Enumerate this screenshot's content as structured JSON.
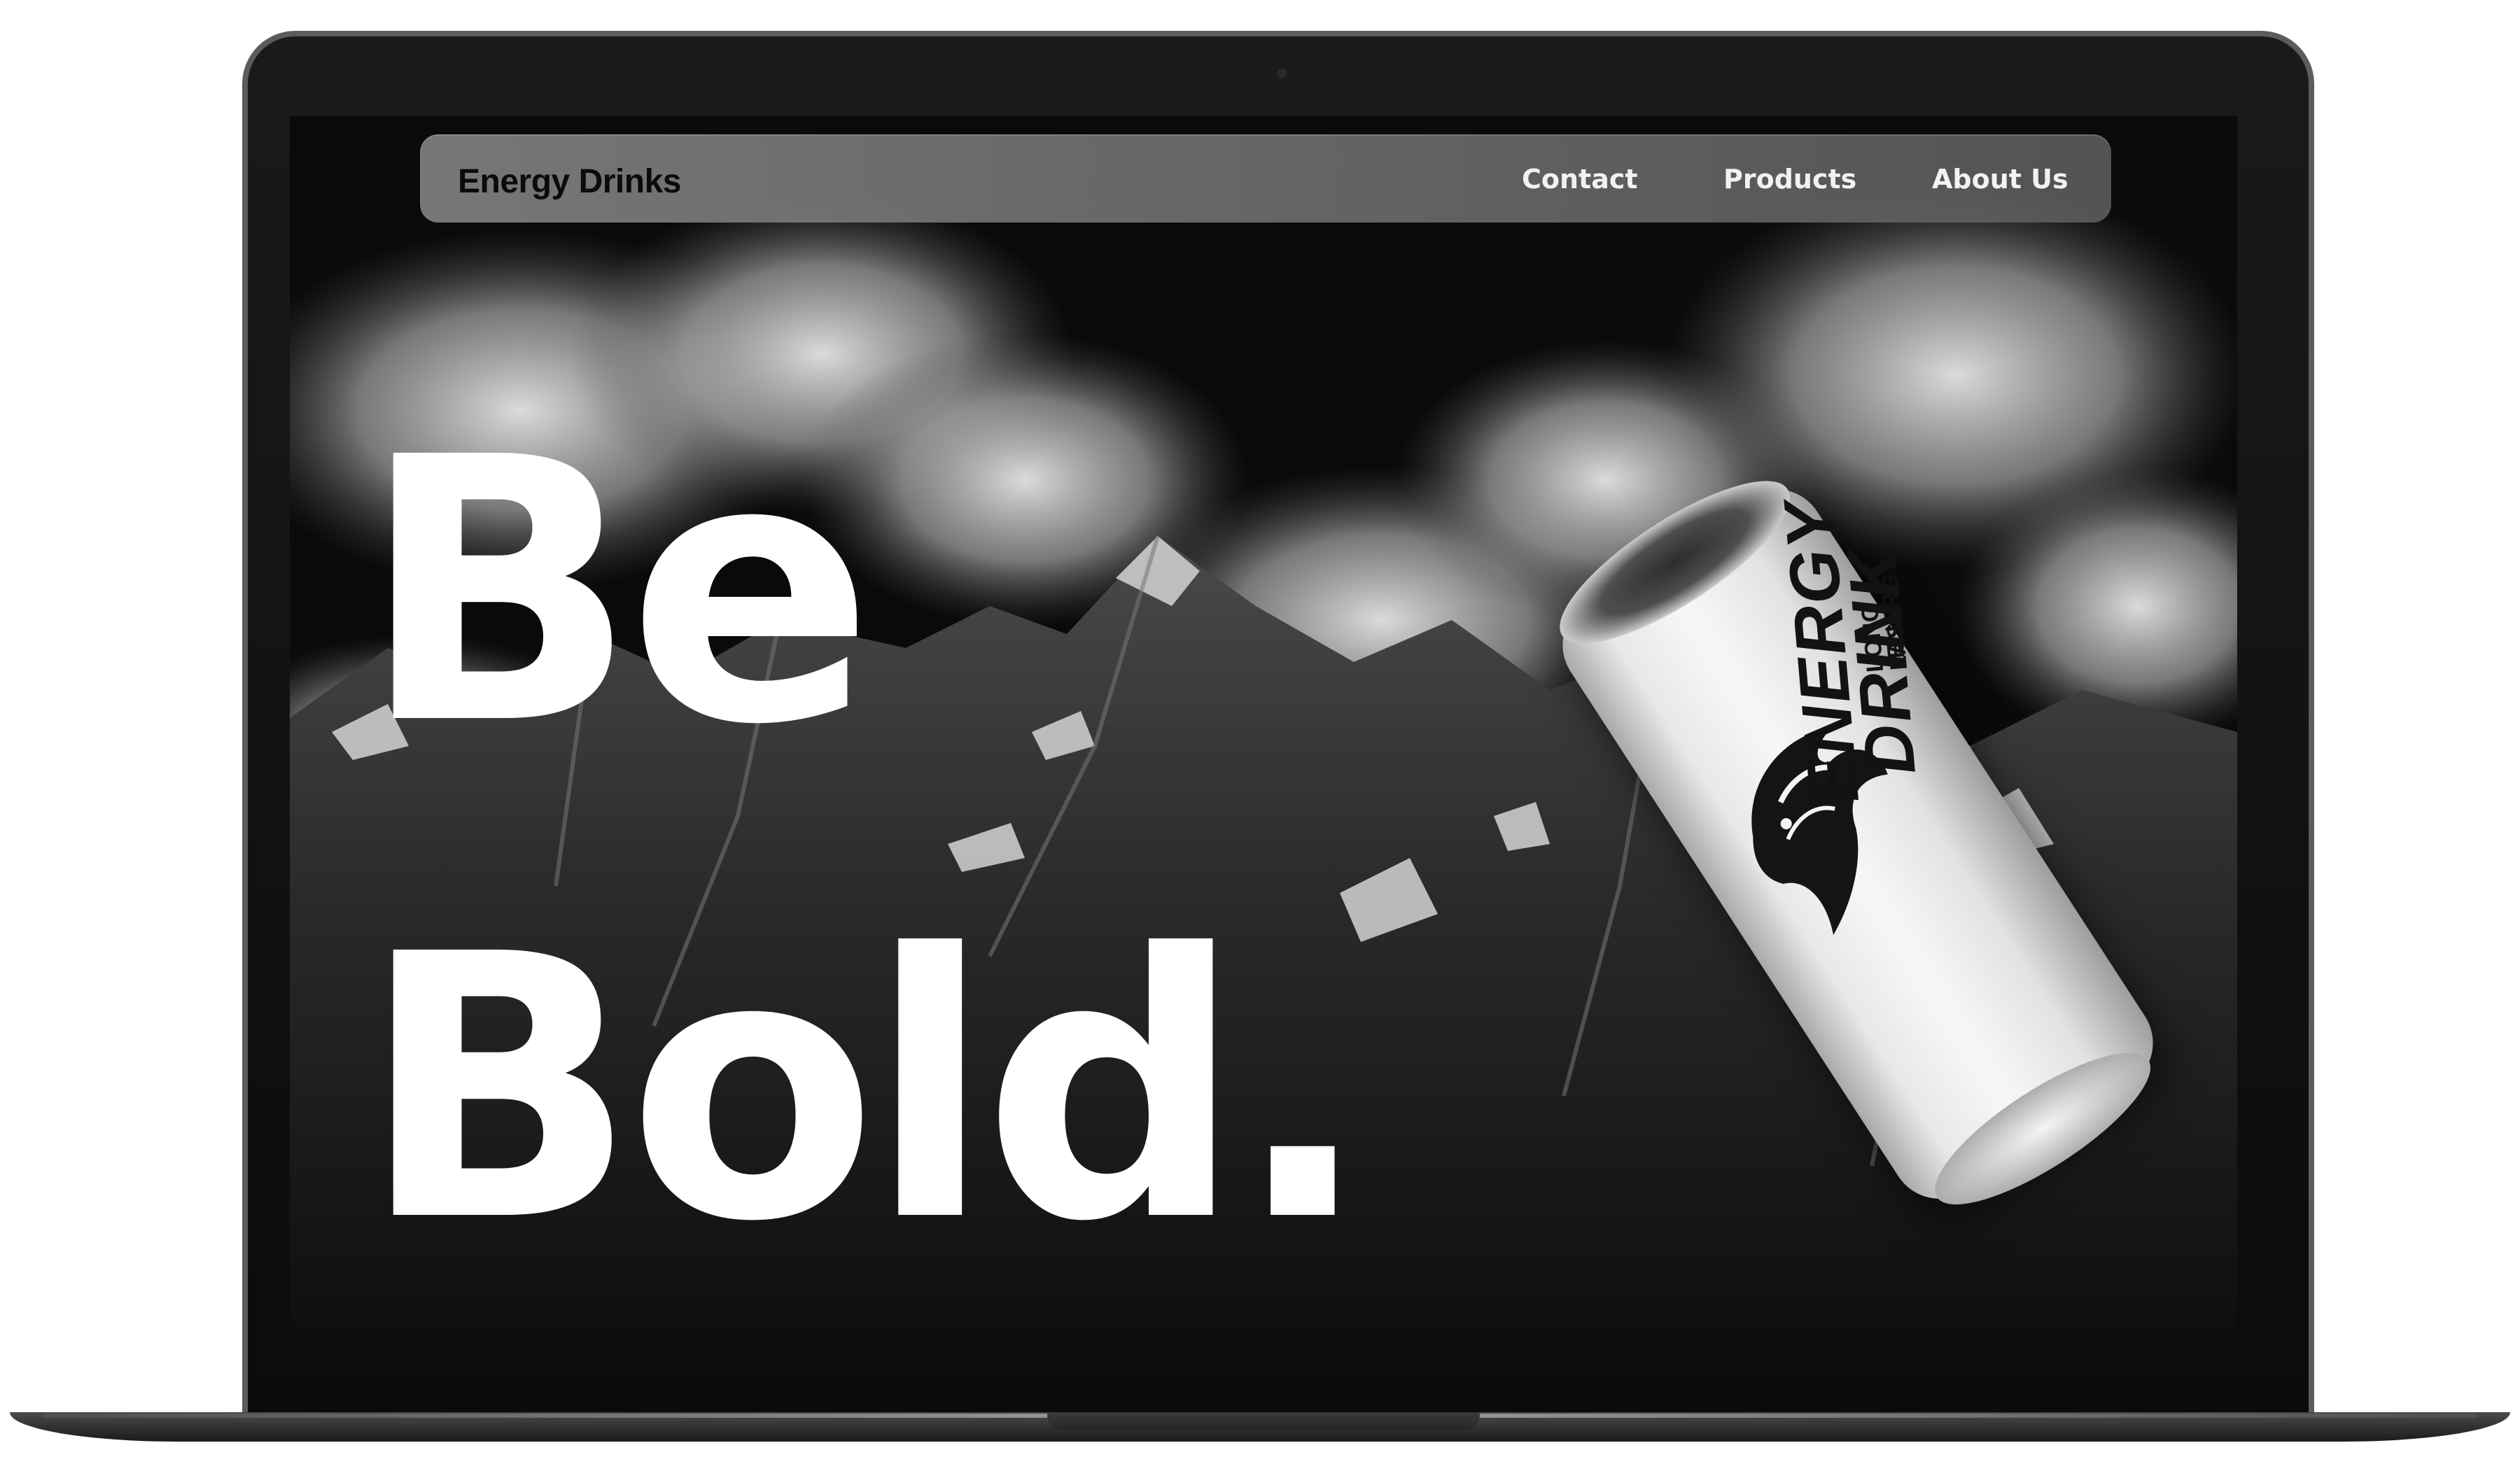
{
  "nav": {
    "brand": "Energy Drinks",
    "links": [
      {
        "label": "Contact"
      },
      {
        "label": "Products"
      },
      {
        "label": "About Us"
      }
    ]
  },
  "hero": {
    "line1": "Be",
    "line2": "Bold."
  },
  "product": {
    "logo_line1": "ENERGY",
    "logo_line2": "DRINK",
    "tagline_1": "LONG LAS",
    "tagline_2": "ENERGY"
  },
  "colors": {
    "headline": "#ffffff",
    "nav_background": "#7a7a7a",
    "brand_text": "#0b0b0b",
    "link_text": "#f2f2f2",
    "bezel": "#111111"
  }
}
